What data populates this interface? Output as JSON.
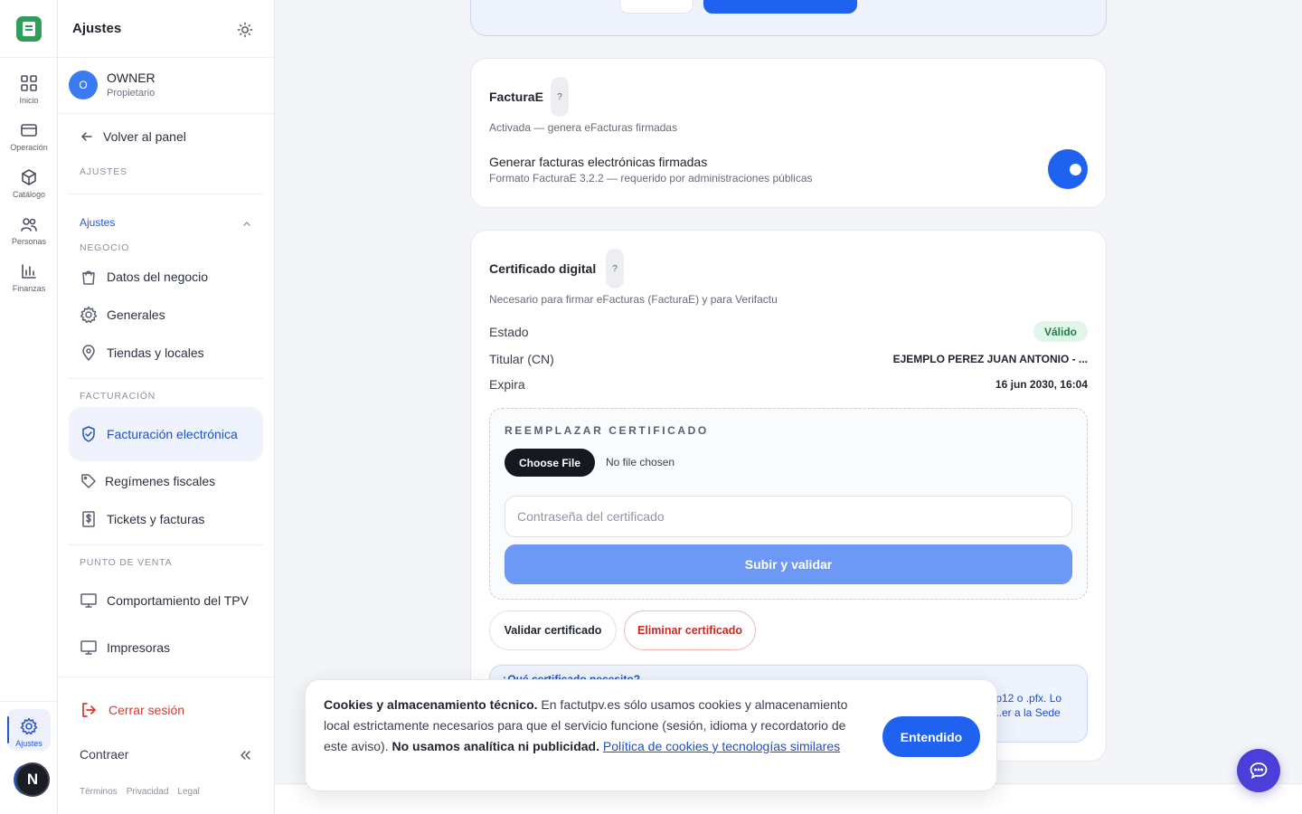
{
  "rail": {
    "items": [
      {
        "label": "Inicio",
        "icon": "grid-icon"
      },
      {
        "label": "Operación",
        "icon": "card-icon"
      },
      {
        "label": "Catálogo",
        "icon": "box-icon"
      },
      {
        "label": "Personas",
        "icon": "users-icon"
      },
      {
        "label": "Finanzas",
        "icon": "chart-icon"
      }
    ],
    "active": {
      "label": "Ajustes",
      "icon": "gear-icon"
    },
    "avatar_letter": "N"
  },
  "sidebar": {
    "title": "Ajustes",
    "user": {
      "initial": "O",
      "name": "OWNER",
      "role": "Propietario"
    },
    "back_label": "Volver al panel",
    "section_label": "AJUSTES",
    "group_label": "Ajustes",
    "negocio": {
      "caption": "NEGOCIO",
      "items": [
        "Datos del negocio",
        "Generales",
        "Tiendas y locales"
      ]
    },
    "facturacion": {
      "caption": "FACTURACIÓN",
      "items": [
        "Facturación electrónica",
        "Regímenes fiscales",
        "Tickets y facturas"
      ]
    },
    "tpv": {
      "caption": "PUNTO DE VENTA",
      "items": [
        "Comportamiento del TPV",
        "Impresoras"
      ]
    },
    "logout_label": "Cerrar sesión",
    "collapse_label": "Contraer",
    "footer": [
      "Términos",
      "Privacidad",
      "Legal"
    ]
  },
  "facturae": {
    "title": "FacturaE",
    "help": "?",
    "status": "Activada — genera eFacturas firmadas",
    "option_title": "Generar facturas electrónicas firmadas",
    "option_sub": "Formato FacturaE 3.2.2 — requerido por administraciones públicas",
    "enabled": true
  },
  "certificate": {
    "title": "Certificado digital",
    "help": "?",
    "subtitle": "Necesario para firmar eFacturas (FacturaE) y para Verifactu",
    "estado_label": "Estado",
    "estado_value": "Válido",
    "titular_label": "Titular (CN)",
    "titular_value": "EJEMPLO PEREZ JUAN ANTONIO - ...",
    "expira_label": "Expira",
    "expira_value": "16 jun 2030, 16:04",
    "replace_caption": "REEMPLAZAR CERTIFICADO",
    "choose_file": "Choose File",
    "no_file": "No file chosen",
    "password_placeholder": "Contraseña del certificado",
    "password_value": "",
    "upload_label": "Subir y validar",
    "validate_label": "Validar certificado",
    "delete_label": "Eliminar certificado",
    "info_title": "¿Qué certificado necesito?",
    "info_text": ".p12 o .pfx. Lo ...er a la Sede"
  },
  "cookie": {
    "bold1": "Cookies y almacenamiento técnico.",
    "text1": " En factutpv.es sólo usamos cookies y almacenamiento local estrictamente necesarios para que el servicio funcione (sesión, idioma y recordatorio de este aviso). ",
    "bold2": "No usamos analítica ni publicidad.",
    "link": "Política de cookies y tecnologías similares",
    "button": "Entendido"
  },
  "colors": {
    "accent": "#1f62f0",
    "brand": "#2f9e5a",
    "danger": "#e0352f",
    "success": "#1c8146"
  }
}
